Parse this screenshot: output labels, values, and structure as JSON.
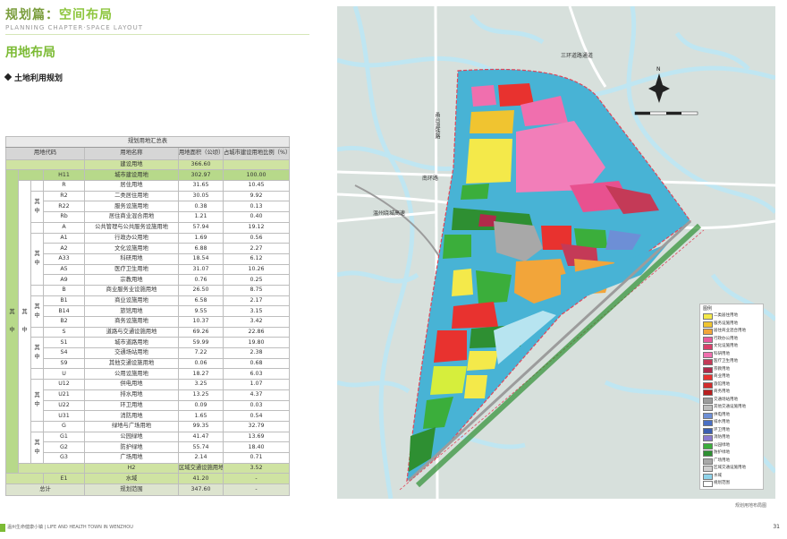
{
  "header": {
    "title_prefix": "规划篇：",
    "title_highlight": "空间布局",
    "subtitle": "PLANNING CHAPTER·SPACE LAYOUT"
  },
  "section_title": "用地布局",
  "subsection_title": "土地利用规划",
  "table": {
    "caption": "规划用地汇总表",
    "headers": [
      "用地代码",
      "用地名称",
      "用地面积（公顷）",
      "占城市建设用地比例（%）"
    ],
    "rows": [
      {
        "cells": [
          "H",
          "建设用地",
          "366.60",
          ""
        ],
        "style": "g"
      },
      {
        "cells": [
          "H11",
          "城市建设用地",
          "302.97",
          "100.00"
        ],
        "style": "hl"
      },
      {
        "cells": [
          "R",
          "居住用地",
          "31.65",
          "10.45"
        ],
        "style": ""
      },
      {
        "cells": [
          "R2",
          "二类居住用地",
          "30.05",
          "9.92"
        ],
        "style": ""
      },
      {
        "cells": [
          "R22",
          "服务设施用地",
          "0.38",
          "0.13"
        ],
        "style": ""
      },
      {
        "cells": [
          "Rb",
          "居住商业混合用地",
          "1.21",
          "0.40"
        ],
        "style": ""
      },
      {
        "cells": [
          "A",
          "公共管理与公共服务设施用地",
          "57.94",
          "19.12"
        ],
        "style": ""
      },
      {
        "cells": [
          "A1",
          "行政办公用地",
          "1.69",
          "0.56"
        ],
        "style": ""
      },
      {
        "cells": [
          "A2",
          "文化设施用地",
          "6.88",
          "2.27"
        ],
        "style": ""
      },
      {
        "cells": [
          "A33",
          "科研用地",
          "18.54",
          "6.12"
        ],
        "style": ""
      },
      {
        "cells": [
          "A5",
          "医疗卫生用地",
          "31.07",
          "10.26"
        ],
        "style": ""
      },
      {
        "cells": [
          "A9",
          "宗教用地",
          "0.76",
          "0.25"
        ],
        "style": ""
      },
      {
        "cells": [
          "B",
          "商业服务业设施用地",
          "26.50",
          "8.75"
        ],
        "style": ""
      },
      {
        "cells": [
          "B1",
          "商业设施用地",
          "6.58",
          "2.17"
        ],
        "style": ""
      },
      {
        "cells": [
          "B14",
          "旅馆用地",
          "9.55",
          "3.15"
        ],
        "style": ""
      },
      {
        "cells": [
          "B2",
          "商务设施用地",
          "10.37",
          "3.42"
        ],
        "style": ""
      },
      {
        "cells": [
          "S",
          "道路与交通设施用地",
          "69.26",
          "22.86"
        ],
        "style": ""
      },
      {
        "cells": [
          "S1",
          "城市道路用地",
          "59.99",
          "19.80"
        ],
        "style": ""
      },
      {
        "cells": [
          "S4",
          "交通场站用地",
          "7.22",
          "2.38"
        ],
        "style": ""
      },
      {
        "cells": [
          "S9",
          "其他交通设施用地",
          "0.06",
          "0.68"
        ],
        "style": ""
      },
      {
        "cells": [
          "U",
          "公用设施用地",
          "18.27",
          "6.03"
        ],
        "style": ""
      },
      {
        "cells": [
          "U12",
          "供电用地",
          "3.25",
          "1.07"
        ],
        "style": ""
      },
      {
        "cells": [
          "U21",
          "排水用地",
          "13.25",
          "4.37"
        ],
        "style": ""
      },
      {
        "cells": [
          "U22",
          "环卫用地",
          "0.09",
          "0.03"
        ],
        "style": ""
      },
      {
        "cells": [
          "U31",
          "消防用地",
          "1.65",
          "0.54"
        ],
        "style": ""
      },
      {
        "cells": [
          "G",
          "绿地与广场用地",
          "99.35",
          "32.79"
        ],
        "style": ""
      },
      {
        "cells": [
          "G1",
          "公园绿地",
          "41.47",
          "13.69"
        ],
        "style": ""
      },
      {
        "cells": [
          "G2",
          "防护绿地",
          "55.74",
          "18.40"
        ],
        "style": ""
      },
      {
        "cells": [
          "G3",
          "广场用地",
          "2.14",
          "0.71"
        ],
        "style": ""
      },
      {
        "cells": [
          "H2",
          "区域交通设施用地",
          "3.52",
          "-"
        ],
        "style": "g"
      },
      {
        "cells": [
          "E1",
          "水域",
          "41.20",
          "-"
        ],
        "style": "g"
      }
    ],
    "merged_labels": {
      "qi": "其",
      "zhong": "中",
      "col1_a": "其",
      "col1_b": "中"
    },
    "total": {
      "label": "总计",
      "name": "规划范围",
      "area": "347.60",
      "ratio": "-"
    }
  },
  "map": {
    "labels": {
      "road_top": "三环道路通道",
      "rail_west": "甬台温铁路",
      "road_nanhuan": "南环路",
      "road_high": "温州绕城高速"
    },
    "caption": "规划用地布局图",
    "legend_title": "图例",
    "legend": [
      {
        "label": "二类居住用地",
        "color": "#f4e94a"
      },
      {
        "label": "服务设施用地",
        "color": "#f0c430"
      },
      {
        "label": "居住商业混合用地",
        "color": "#f2a53a"
      },
      {
        "label": "行政办公用地",
        "color": "#e85a9c"
      },
      {
        "label": "文化设施用地",
        "color": "#d8406a"
      },
      {
        "label": "科研用地",
        "color": "#f06fae"
      },
      {
        "label": "医疗卫生用地",
        "color": "#c43a57"
      },
      {
        "label": "宗教用地",
        "color": "#b02a4a"
      },
      {
        "label": "商业用地",
        "color": "#e8322f"
      },
      {
        "label": "旅馆用地",
        "color": "#d22d2d"
      },
      {
        "label": "商务用地",
        "color": "#b81f1f"
      },
      {
        "label": "交通场站用地",
        "color": "#9c9c9c"
      },
      {
        "label": "其他交通设施用地",
        "color": "#bdbdbd"
      },
      {
        "label": "供电用地",
        "color": "#6d8fd6"
      },
      {
        "label": "排水用地",
        "color": "#4a6fc4"
      },
      {
        "label": "环卫用地",
        "color": "#3c5fb0"
      },
      {
        "label": "消防用地",
        "color": "#8a7ad0"
      },
      {
        "label": "公园绿地",
        "color": "#3bae3b"
      },
      {
        "label": "防护绿地",
        "color": "#2e8f32"
      },
      {
        "label": "广场用地",
        "color": "#a8a8a8"
      },
      {
        "label": "区域交通设施用地",
        "color": "#cfcfcf"
      },
      {
        "label": "水域",
        "color": "#8fd3ea"
      },
      {
        "label": "规划范围",
        "color": "#ffffff"
      }
    ]
  },
  "footer": {
    "left": "温州生命健康小镇 | LIFE AND HEALTH TOWN IN WENZHOU",
    "page": "31"
  }
}
